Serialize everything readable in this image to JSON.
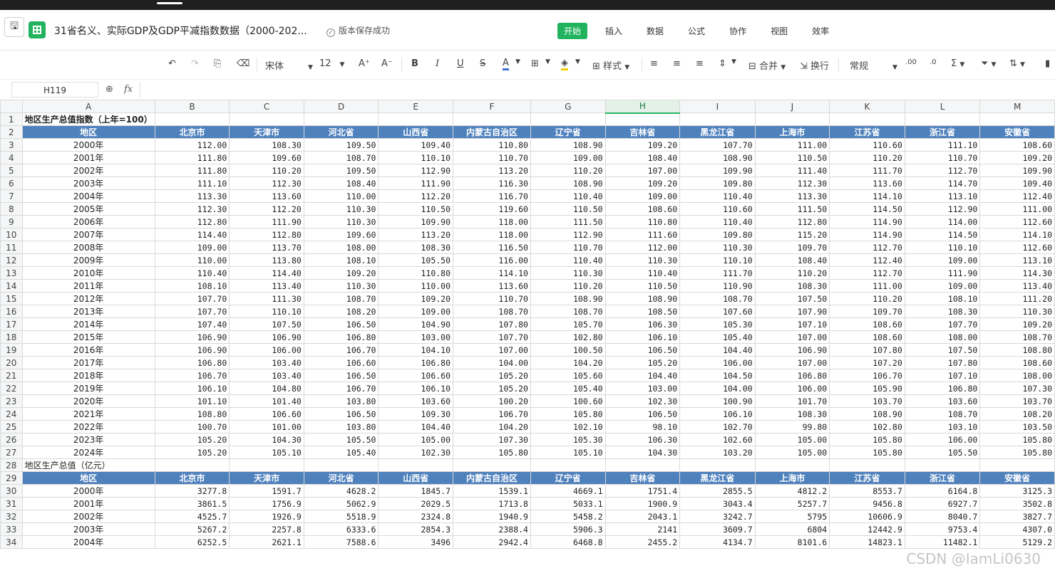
{
  "app": {
    "doc_title": "31省名义、实际GDP及GDP平减指数数据（2000-202...",
    "save_status": "版本保存成功"
  },
  "menu": [
    "开始",
    "插入",
    "数据",
    "公式",
    "协作",
    "视图",
    "效率"
  ],
  "toolbar": {
    "font_name": "宋体",
    "font_size": "12",
    "style_label": "样式",
    "merge_label": "合并",
    "wrap_label": "换行",
    "number_format": "常规"
  },
  "formula_bar": {
    "cell_ref": "H119",
    "fx": "fx"
  },
  "columns": [
    "A",
    "B",
    "C",
    "D",
    "E",
    "F",
    "G",
    "H",
    "I",
    "J",
    "K",
    "L",
    "M"
  ],
  "selected_column": "H",
  "table1": {
    "title": "地区生产总值指数（上年=100）",
    "headers": [
      "地区",
      "北京市",
      "天津市",
      "河北省",
      "山西省",
      "内蒙古自治区",
      "辽宁省",
      "吉林省",
      "黑龙江省",
      "上海市",
      "江苏省",
      "浙江省",
      "安徽省"
    ],
    "rows": [
      [
        "2000年",
        "112.00",
        "108.30",
        "109.50",
        "109.40",
        "110.80",
        "108.90",
        "109.20",
        "107.70",
        "111.00",
        "110.60",
        "111.10",
        "108.60"
      ],
      [
        "2001年",
        "111.80",
        "109.60",
        "108.70",
        "110.10",
        "110.70",
        "109.00",
        "108.40",
        "108.90",
        "110.50",
        "110.20",
        "110.70",
        "109.20"
      ],
      [
        "2002年",
        "111.80",
        "110.20",
        "109.50",
        "112.90",
        "113.20",
        "110.20",
        "107.00",
        "109.90",
        "111.40",
        "111.70",
        "112.70",
        "109.90"
      ],
      [
        "2003年",
        "111.10",
        "112.30",
        "108.40",
        "111.90",
        "116.30",
        "108.90",
        "109.20",
        "109.80",
        "112.30",
        "113.60",
        "114.70",
        "109.40"
      ],
      [
        "2004年",
        "113.30",
        "113.60",
        "110.00",
        "112.20",
        "116.70",
        "110.40",
        "109.00",
        "110.40",
        "113.30",
        "114.10",
        "113.10",
        "112.40"
      ],
      [
        "2005年",
        "112.30",
        "112.20",
        "110.30",
        "110.50",
        "119.60",
        "110.50",
        "108.60",
        "110.60",
        "111.50",
        "114.50",
        "112.90",
        "111.00"
      ],
      [
        "2006年",
        "112.80",
        "111.90",
        "110.30",
        "109.90",
        "118.00",
        "111.50",
        "110.80",
        "110.40",
        "112.80",
        "114.90",
        "114.00",
        "112.60"
      ],
      [
        "2007年",
        "114.40",
        "112.80",
        "109.60",
        "113.20",
        "118.00",
        "112.90",
        "111.60",
        "109.80",
        "115.20",
        "114.90",
        "114.50",
        "114.10"
      ],
      [
        "2008年",
        "109.00",
        "113.70",
        "108.00",
        "108.30",
        "116.50",
        "110.70",
        "112.00",
        "110.30",
        "109.70",
        "112.70",
        "110.10",
        "112.60"
      ],
      [
        "2009年",
        "110.00",
        "113.80",
        "108.10",
        "105.50",
        "116.00",
        "110.40",
        "110.30",
        "110.10",
        "108.40",
        "112.40",
        "109.00",
        "113.10"
      ],
      [
        "2010年",
        "110.40",
        "114.40",
        "109.20",
        "110.80",
        "114.10",
        "110.30",
        "110.40",
        "111.70",
        "110.20",
        "112.70",
        "111.90",
        "114.30"
      ],
      [
        "2011年",
        "108.10",
        "113.40",
        "110.30",
        "110.00",
        "113.60",
        "110.20",
        "110.50",
        "110.90",
        "108.30",
        "111.00",
        "109.00",
        "113.40"
      ],
      [
        "2012年",
        "107.70",
        "111.30",
        "108.70",
        "109.20",
        "110.70",
        "108.90",
        "108.90",
        "108.70",
        "107.50",
        "110.20",
        "108.10",
        "111.20"
      ],
      [
        "2013年",
        "107.70",
        "110.10",
        "108.20",
        "109.00",
        "108.70",
        "108.70",
        "108.50",
        "107.60",
        "107.90",
        "109.70",
        "108.30",
        "110.30"
      ],
      [
        "2014年",
        "107.40",
        "107.50",
        "106.50",
        "104.90",
        "107.80",
        "105.70",
        "106.30",
        "105.30",
        "107.10",
        "108.60",
        "107.70",
        "109.20"
      ],
      [
        "2015年",
        "106.90",
        "106.90",
        "106.80",
        "103.00",
        "107.70",
        "102.80",
        "106.10",
        "105.40",
        "107.00",
        "108.60",
        "108.00",
        "108.70"
      ],
      [
        "2016年",
        "106.90",
        "106.00",
        "106.70",
        "104.10",
        "107.00",
        "100.50",
        "106.50",
        "104.40",
        "106.90",
        "107.80",
        "107.50",
        "108.80"
      ],
      [
        "2017年",
        "106.80",
        "103.40",
        "106.60",
        "106.80",
        "104.00",
        "104.20",
        "105.20",
        "106.00",
        "107.00",
        "107.20",
        "107.80",
        "108.60"
      ],
      [
        "2018年",
        "106.70",
        "103.40",
        "106.50",
        "106.60",
        "105.20",
        "105.60",
        "104.40",
        "104.50",
        "106.80",
        "106.70",
        "107.10",
        "108.00"
      ],
      [
        "2019年",
        "106.10",
        "104.80",
        "106.70",
        "106.10",
        "105.20",
        "105.40",
        "103.00",
        "104.00",
        "106.00",
        "105.90",
        "106.80",
        "107.30"
      ],
      [
        "2020年",
        "101.10",
        "101.40",
        "103.80",
        "103.60",
        "100.20",
        "100.60",
        "102.30",
        "100.90",
        "101.70",
        "103.70",
        "103.60",
        "103.70"
      ],
      [
        "2021年",
        "108.80",
        "106.60",
        "106.50",
        "109.30",
        "106.70",
        "105.80",
        "106.50",
        "106.10",
        "108.30",
        "108.90",
        "108.70",
        "108.20"
      ],
      [
        "2022年",
        "100.70",
        "101.00",
        "103.80",
        "104.40",
        "104.20",
        "102.10",
        "98.10",
        "102.70",
        "99.80",
        "102.80",
        "103.10",
        "103.50"
      ],
      [
        "2023年",
        "105.20",
        "104.30",
        "105.50",
        "105.00",
        "107.30",
        "105.30",
        "106.30",
        "102.60",
        "105.00",
        "105.80",
        "106.00",
        "105.80"
      ],
      [
        "2024年",
        "105.20",
        "105.10",
        "105.40",
        "102.30",
        "105.80",
        "105.10",
        "104.30",
        "103.20",
        "105.00",
        "105.80",
        "105.50",
        "105.80"
      ]
    ]
  },
  "table2": {
    "title": "地区生产总值（亿元）",
    "headers": [
      "地区",
      "北京市",
      "天津市",
      "河北省",
      "山西省",
      "内蒙古自治区",
      "辽宁省",
      "吉林省",
      "黑龙江省",
      "上海市",
      "江苏省",
      "浙江省",
      "安徽省"
    ],
    "rows": [
      [
        "2000年",
        "3277.8",
        "1591.7",
        "4628.2",
        "1845.7",
        "1539.1",
        "4669.1",
        "1751.4",
        "2855.5",
        "4812.2",
        "8553.7",
        "6164.8",
        "3125.3"
      ],
      [
        "2001年",
        "3861.5",
        "1756.9",
        "5062.9",
        "2029.5",
        "1713.8",
        "5033.1",
        "1900.9",
        "3043.4",
        "5257.7",
        "9456.8",
        "6927.7",
        "3502.8"
      ],
      [
        "2002年",
        "4525.7",
        "1926.9",
        "5518.9",
        "2324.8",
        "1940.9",
        "5458.2",
        "2043.1",
        "3242.7",
        "5795",
        "10606.9",
        "8040.7",
        "3827.7"
      ],
      [
        "2003年",
        "5267.2",
        "2257.8",
        "6333.6",
        "2854.3",
        "2388.4",
        "5906.3",
        "2141",
        "3609.7",
        "6804",
        "12442.9",
        "9753.4",
        "4307.0"
      ],
      [
        "2004年",
        "6252.5",
        "2621.1",
        "7588.6",
        "3496",
        "2942.4",
        "6468.8",
        "2455.2",
        "4134.7",
        "8101.6",
        "14823.1",
        "11482.1",
        "5129.2"
      ]
    ]
  },
  "watermark": "CSDN @IamLi0630"
}
